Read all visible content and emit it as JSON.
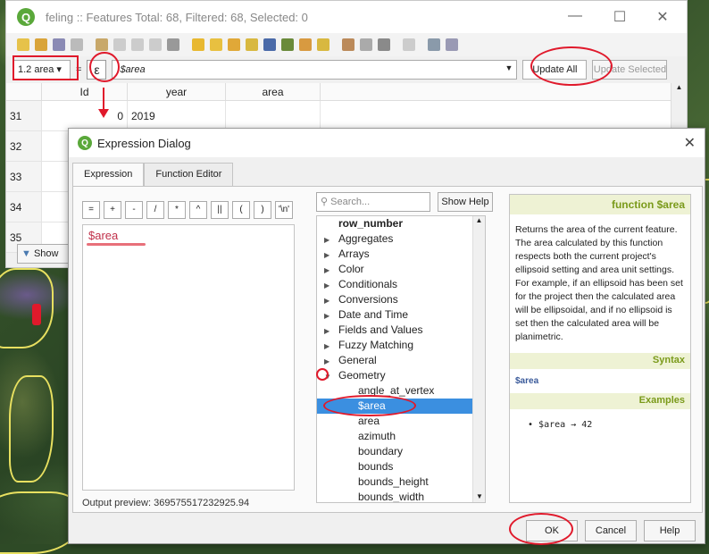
{
  "attribute_table": {
    "title": "feling :: Features Total: 68, Filtered: 68, Selected: 0",
    "field_combo": "1.2 area",
    "expression_placeholder": "$area",
    "update_all": "Update All",
    "update_selected": "Update Selected",
    "columns": [
      "Id",
      "year",
      "area"
    ],
    "rows": [
      {
        "num": "31",
        "id": "0",
        "year": "2019",
        "area": ""
      },
      {
        "num": "32",
        "id": "",
        "year": "",
        "area": ""
      },
      {
        "num": "33",
        "id": "",
        "year": "",
        "area": ""
      },
      {
        "num": "34",
        "id": "",
        "year": "",
        "area": ""
      },
      {
        "num": "35",
        "id": "",
        "year": "",
        "area": ""
      }
    ],
    "show_label": "Show"
  },
  "dialog": {
    "title": "Expression Dialog",
    "tabs": [
      "Expression",
      "Function Editor"
    ],
    "operators": [
      "=",
      "+",
      "-",
      "/",
      "*",
      "^",
      "||",
      "(",
      ")",
      "'\\n'"
    ],
    "expression": "$area",
    "output_preview": "Output preview:  369575517232925.94",
    "search_placeholder": "Search...",
    "show_help": "Show Help",
    "function_groups": [
      "row_number",
      "Aggregates",
      "Arrays",
      "Color",
      "Conditionals",
      "Conversions",
      "Date and Time",
      "Fields and Values",
      "Fuzzy Matching",
      "General",
      "Geometry"
    ],
    "geometry_functions": [
      "angle_at_vertex",
      "$area",
      "area",
      "azimuth",
      "boundary",
      "bounds",
      "bounds_height",
      "bounds_width"
    ],
    "help": {
      "heading": "function $area",
      "description": "Returns the area of the current feature. The area calculated by this function respects both the current project's ellipsoid setting and area unit settings. For example, if an ellipsoid has been set for the project then the calculated area will be ellipsoidal, and if no ellipsoid is set then the calculated area will be planimetric.",
      "syntax_label": "Syntax",
      "syntax": "$area",
      "examples_label": "Examples",
      "example": "$area → 42"
    },
    "ok": "OK",
    "cancel": "Cancel",
    "help_button": "Help"
  },
  "colors": {
    "annotation": "#e0192b",
    "selection": "#3b8fe0",
    "help_accent": "#7a9a1a"
  }
}
